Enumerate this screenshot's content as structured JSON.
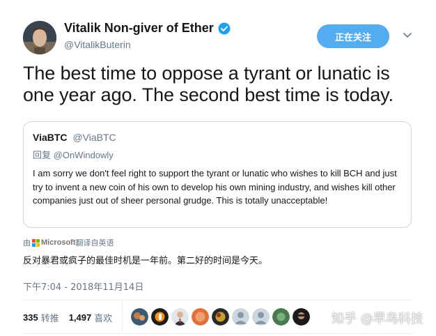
{
  "author": {
    "name": "Vitalik Non-giver of Ether",
    "handle": "@VitalikButerin"
  },
  "follow_button_label": "正在关注",
  "tweet_text": "The best time to oppose a tyrant or lunatic is one year ago. The second best time is today.",
  "quoted_tweet": {
    "name": "ViaBTC",
    "handle": "@ViaBTC",
    "reply_label": "回复",
    "reply_to": "@OnWindowly",
    "body": "I am sorry we don't feel right to support the tyrant or lunatic who wishes to kill BCH and just try to invent a new coin of his own to develop his own mining industry, and wishes kill other companies just out of sheer personal grudge. This is totally unacceptable!"
  },
  "translation": {
    "by_prefix": "由",
    "provider": "Microsoft",
    "suffix": "翻译自英语",
    "text": "反对暴君或疯子的最佳时机是一年前。第二好的时间是今天。"
  },
  "timestamp": "下午7:04 - 2018年11月14日",
  "stats": {
    "retweets_count": "335",
    "retweets_label": "转推",
    "likes_count": "1,497",
    "likes_label": "喜欢"
  },
  "watermark": "知乎 @早鸟科技",
  "colors": {
    "accent": "#52acef",
    "verified": "#1da1f2",
    "secondary_text": "#657786",
    "border": "#ccd6dd"
  }
}
